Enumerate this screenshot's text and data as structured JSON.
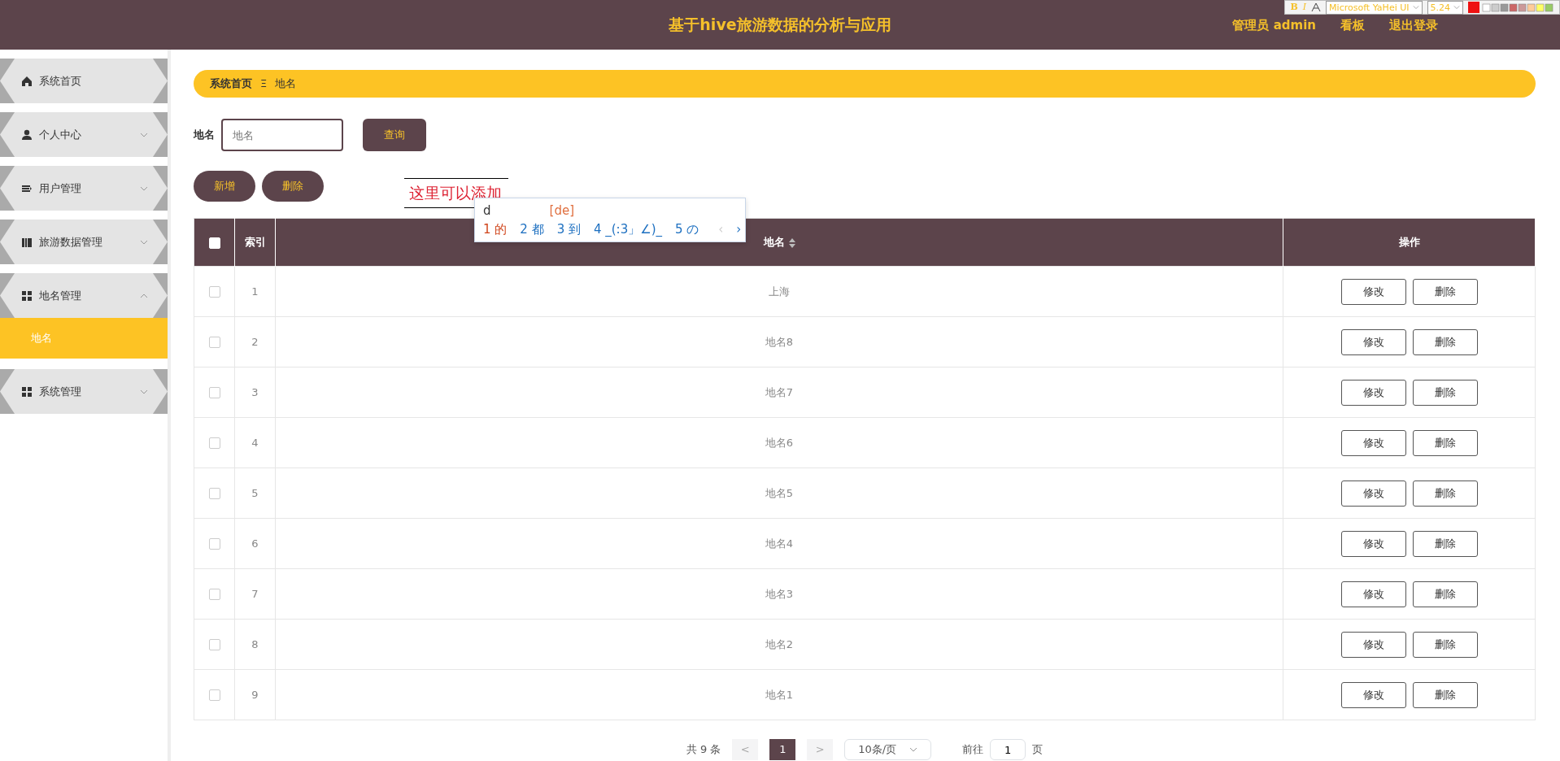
{
  "header": {
    "title": "基于hive旅游数据的分析与应用",
    "links": [
      "管理员 admin",
      "看板",
      "退出登录"
    ]
  },
  "editor_toolbar": {
    "bold": "B",
    "italic": "I",
    "font": "Microsoft YaHei UI",
    "size": "5.24"
  },
  "sidebar": {
    "items": [
      {
        "label": "系统首页"
      },
      {
        "label": "个人中心",
        "expanded": false
      },
      {
        "label": "用户管理",
        "expanded": false
      },
      {
        "label": "旅游数据管理",
        "expanded": false
      },
      {
        "label": "地名管理",
        "expanded": true,
        "children": [
          {
            "label": "地名",
            "selected": true
          }
        ]
      },
      {
        "label": "系统管理",
        "expanded": false
      }
    ]
  },
  "breadcrumb": {
    "items": [
      "系统首页",
      "地名"
    ],
    "separator": "Ξ"
  },
  "search": {
    "label": "地名",
    "placeholder": "地名",
    "button": "查询"
  },
  "actions": [
    "新增",
    "删除"
  ],
  "annotation": {
    "text": "这里可以添加"
  },
  "ime": {
    "input": "d",
    "pinyin": "[de]",
    "candidates": [
      {
        "num": "1",
        "text": "的",
        "selected": true
      },
      {
        "num": "2",
        "text": "都",
        "selected": false
      },
      {
        "num": "3",
        "text": "到",
        "selected": false
      },
      {
        "num": "4",
        "text": "_(:3」∠)_",
        "selected": false
      },
      {
        "num": "5",
        "text": "の",
        "selected": false
      }
    ],
    "prev": "‹",
    "next": "›"
  },
  "table": {
    "checked": false,
    "columns": [
      {
        "label": "索引"
      },
      {
        "label": "地名",
        "sortable": true
      },
      {
        "label": "操作"
      }
    ],
    "rows": [
      {
        "checked": false,
        "index": "1",
        "name": "上海",
        "actions": [
          "修改",
          "删除"
        ]
      },
      {
        "checked": false,
        "index": "2",
        "name": "地名8",
        "actions": [
          "修改",
          "删除"
        ]
      },
      {
        "checked": false,
        "index": "3",
        "name": "地名7",
        "actions": [
          "修改",
          "删除"
        ]
      },
      {
        "checked": false,
        "index": "4",
        "name": "地名6",
        "actions": [
          "修改",
          "删除"
        ]
      },
      {
        "checked": false,
        "index": "5",
        "name": "地名5",
        "actions": [
          "修改",
          "删除"
        ]
      },
      {
        "checked": false,
        "index": "6",
        "name": "地名4",
        "actions": [
          "修改",
          "删除"
        ]
      },
      {
        "checked": false,
        "index": "7",
        "name": "地名3",
        "actions": [
          "修改",
          "删除"
        ]
      },
      {
        "checked": false,
        "index": "8",
        "name": "地名2",
        "actions": [
          "修改",
          "删除"
        ]
      },
      {
        "checked": false,
        "index": "9",
        "name": "地名1",
        "actions": [
          "修改",
          "删除"
        ]
      }
    ]
  },
  "pagination": {
    "total": "共 9 条",
    "prev": "<",
    "pages": [
      {
        "label": "1",
        "selected": true
      }
    ],
    "next": ">",
    "page_size": "10条/页",
    "goto_label": "前往",
    "goto_value": "1",
    "goto_suffix": "页"
  }
}
